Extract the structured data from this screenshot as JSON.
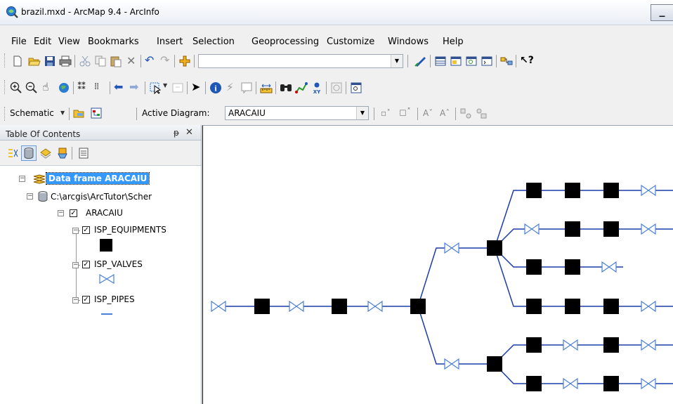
{
  "window": {
    "title": "brazil.mxd - ArcMap 9.4 - ArcInfo",
    "minimize_glyph": "_"
  },
  "menu": [
    "File",
    "Edit",
    "View",
    "Bookmarks",
    "Insert",
    "Selection",
    "Geoprocessing",
    "Customize",
    "Windows",
    "Help"
  ],
  "toolbar1": {
    "icons": [
      "new-icon",
      "open-icon",
      "save-icon",
      "print-icon",
      "cut-icon",
      "copy-icon",
      "paste-icon",
      "delete-icon",
      "undo-icon",
      "redo-icon",
      "add-data-icon",
      "editor-icon",
      "table-window-icon",
      "catalog-icon",
      "search-window-icon",
      "python-icon",
      "model-builder-icon",
      "whats-this-icon"
    ],
    "scale_value": ""
  },
  "toolbar2": {
    "icons": [
      "zoom-in-icon",
      "zoom-out-icon",
      "pan-icon",
      "full-extent-icon",
      "fixed-zoom-in-icon",
      "fixed-zoom-out-icon",
      "back-icon",
      "forward-icon",
      "select-features-icon",
      "clear-selection-icon",
      "select-elements-icon",
      "identify-icon",
      "hyperlink-icon",
      "html-popup-icon",
      "measure-icon",
      "find-icon",
      "find-route-icon",
      "goto-xy-icon",
      "time-slider-icon",
      "create-viewer-icon"
    ]
  },
  "schematic_toolbar": {
    "schematic_label": "Schematic",
    "active_diagram_label": "Active Diagram:",
    "active_diagram_value": "ARACAIU"
  },
  "toc": {
    "title": "Table Of Contents",
    "pin_glyph": "ᵽ",
    "close_glyph": "✕",
    "tree": {
      "data_frame": "Data frame ARACAIU",
      "workspace": "C:\\arcgis\\ArcTutor\\Scher",
      "dataset": "ARACAIU",
      "layers": [
        "ISP_EQUIPMENTS",
        "ISP_VALVES",
        "ISP_PIPES"
      ]
    }
  },
  "colors": {
    "pipe": "#1a3da8",
    "valve": "#4a7fd8",
    "equipment": "#000000",
    "selection_highlight": "#3399ff"
  }
}
